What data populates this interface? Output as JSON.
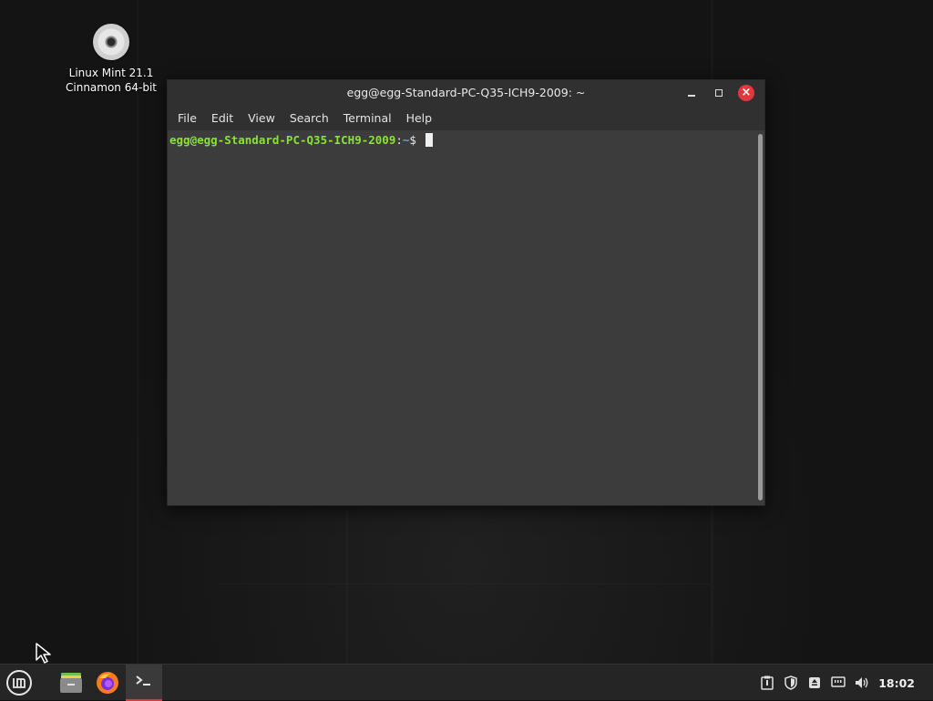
{
  "desktop": {
    "icons": [
      {
        "label_line1": "Linux Mint 21.1",
        "label_line2": "Cinnamon 64-bit",
        "icon": "disc-icon"
      }
    ]
  },
  "terminal": {
    "title": "egg@egg-Standard-PC-Q35-ICH9-2009: ~",
    "menu": [
      "File",
      "Edit",
      "View",
      "Search",
      "Terminal",
      "Help"
    ],
    "prompt_user": "egg@egg-Standard-PC-Q35-ICH9-2009",
    "prompt_sep": ":",
    "prompt_path": "~",
    "prompt_symbol": "$ "
  },
  "taskbar": {
    "launchers": [
      "menu-icon",
      "files-icon",
      "firefox-icon",
      "terminal-icon"
    ],
    "tray_icons": [
      "update-manager-icon",
      "shield-icon",
      "removable-drive-icon",
      "network-icon",
      "volume-icon"
    ],
    "clock": "18:02"
  },
  "colors": {
    "close_button": "#e0383e",
    "prompt_user": "#8ae234",
    "prompt_path": "#729fcf",
    "taskbar_bg": "#252525"
  }
}
